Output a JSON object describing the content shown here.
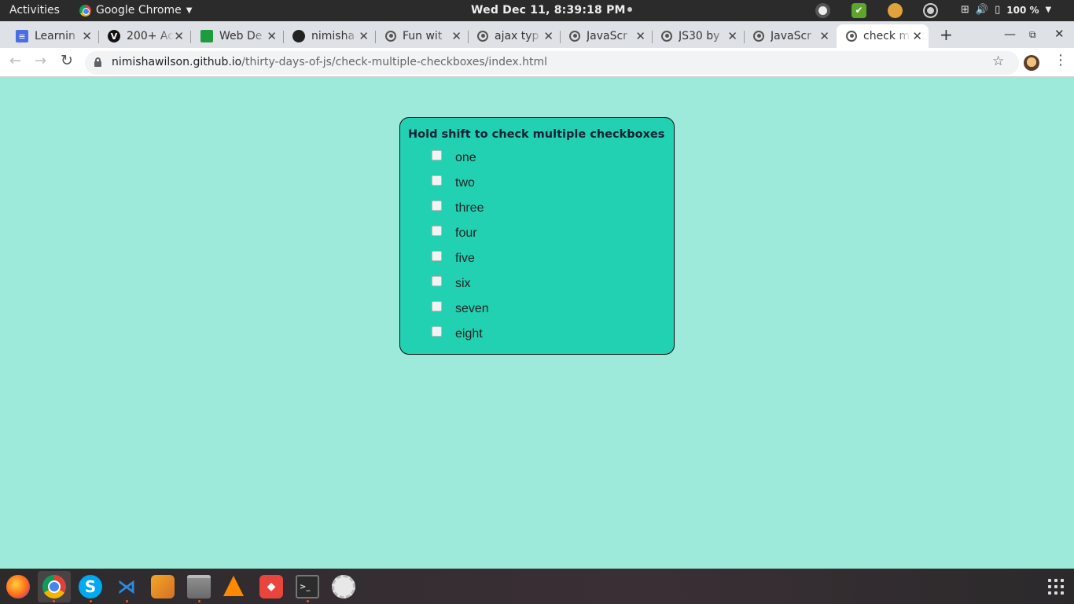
{
  "topbar": {
    "activities": "Activities",
    "app_name": "Google Chrome",
    "clock": "Wed Dec 11,  8:39:18 PM",
    "battery_percent": "100 %"
  },
  "tabs": [
    {
      "title": "Learnin",
      "favicon": "google-docs-icon"
    },
    {
      "title": "200+ Ac",
      "favicon": "v-logo-icon"
    },
    {
      "title": "Web De",
      "favicon": "trello-icon"
    },
    {
      "title": "nimisha",
      "favicon": "github-icon"
    },
    {
      "title": "Fun wit",
      "favicon": "globe-icon"
    },
    {
      "title": "ajax typ",
      "favicon": "globe-icon"
    },
    {
      "title": "JavaScr",
      "favicon": "globe-icon"
    },
    {
      "title": "JS30 by",
      "favicon": "globe-icon"
    },
    {
      "title": "JavaScr",
      "favicon": "globe-icon"
    },
    {
      "title": "check m",
      "favicon": "globe-icon",
      "active": true
    }
  ],
  "address_bar": {
    "host": "nimishawilson.github.io",
    "path": "/thirty-days-of-js/check-multiple-checkboxes/index.html"
  },
  "inbox": {
    "title": "Hold shift to check multiple checkboxes",
    "items": [
      {
        "label": "one",
        "checked": false
      },
      {
        "label": "two",
        "checked": false
      },
      {
        "label": "three",
        "checked": false
      },
      {
        "label": "four",
        "checked": false
      },
      {
        "label": "five",
        "checked": false
      },
      {
        "label": "six",
        "checked": false
      },
      {
        "label": "seven",
        "checked": false
      },
      {
        "label": "eight",
        "checked": false
      }
    ]
  },
  "dock": {
    "apps": [
      "firefox-icon",
      "chrome-icon",
      "skype-icon",
      "vscode-icon",
      "blender-icon",
      "files-icon",
      "vlc-icon",
      "git-client-icon",
      "terminal-icon",
      "settings-icon"
    ]
  },
  "colors": {
    "page_bg": "#9eeada",
    "inbox_bg": "#21d1b2",
    "topbar_bg": "#2b2b2b",
    "tabstrip_bg": "#dee1e6"
  }
}
